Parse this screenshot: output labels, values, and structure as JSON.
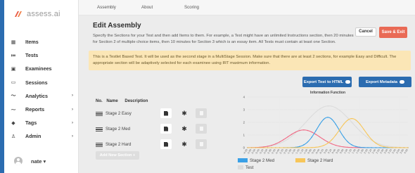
{
  "brand": {
    "logo_text": "assess.ai"
  },
  "sidebar": {
    "items": [
      {
        "label": "Items",
        "icon": "grid-icon",
        "has_chevron": false
      },
      {
        "label": "Tests",
        "icon": "list-icon",
        "has_chevron": false
      },
      {
        "label": "Examinees",
        "icon": "id-card-icon",
        "has_chevron": false
      },
      {
        "label": "Sessions",
        "icon": "calendar-icon",
        "has_chevron": false
      },
      {
        "label": "Analytics",
        "icon": "trend-icon",
        "has_chevron": true
      },
      {
        "label": "Reports",
        "icon": "report-icon",
        "has_chevron": true
      },
      {
        "label": "Tags",
        "icon": "tag-icon",
        "has_chevron": true
      },
      {
        "label": "Admin",
        "icon": "admin-icon",
        "has_chevron": true
      }
    ],
    "user": {
      "name": "nate ▾"
    }
  },
  "topnav": {
    "tabs": [
      "Assembly",
      "About",
      "Scoring"
    ]
  },
  "page": {
    "title": "Edit Assembly",
    "description": "Specify the Sections for your Test and then add Items to them. For example, a Test might have an unlimited Instructions section, then 20 minutes for Section 2 of multiple choice items, then 10 minutes for Section 3 which is an essay item. All Tests must contain at least one Section.",
    "cancel_label": "Cancel",
    "save_label": "Save & Exit",
    "banner": "This is a Testlet Based Test. It will be used as the second stage in a MultiStage Session. Make sure that there are at least 2 sections, for example Easy and Difficult. The appropriate section will be adaptively selected for each examinee using IRT maximum information.",
    "export_html_label": "Export Test to HTML",
    "export_meta_label": "Export Metadata"
  },
  "sections_table": {
    "headers": {
      "no": "No.",
      "name": "Name",
      "description": "Description"
    },
    "rows": [
      {
        "name": "Stage 2 Easy"
      },
      {
        "name": "Stage 2 Med"
      },
      {
        "name": "Stage 2 Hard"
      }
    ],
    "add_label": "Add New Section +"
  },
  "chart_data": {
    "type": "line",
    "title": "Information Function",
    "ylim": [
      0,
      4
    ],
    "yticks": [
      0,
      1,
      2,
      3,
      4
    ],
    "x": [
      -4.0,
      -3.8,
      -3.6,
      -3.4,
      -3.2,
      -3.0,
      -2.8,
      -2.6,
      -2.4,
      -2.2,
      -2.0,
      -1.8,
      -1.6,
      -1.4,
      -1.2,
      -1.0,
      -0.8,
      -0.6,
      -0.4,
      -0.2,
      0.0,
      0.2,
      0.4,
      0.6,
      0.8,
      1.0,
      1.2,
      1.4,
      1.6,
      1.8,
      2.0,
      2.2,
      2.4,
      2.6,
      2.8,
      3.0,
      3.2,
      3.4,
      3.6,
      3.8,
      4.0
    ],
    "xtick_labels": [
      "-4.00",
      "-3.80",
      "-3.60",
      "-3.40",
      "-3.20",
      "-3.00",
      "-2.80",
      "-2.60",
      "-2.40",
      "-2.20",
      "-2.00",
      "-1.80",
      "-1.60",
      "-1.40",
      "-1.20",
      "-1.00",
      "-0.80",
      "-0.60",
      "-0.40",
      "-0.20",
      "0.00",
      "0.20",
      "0.40",
      "0.60",
      "0.80",
      "1.00",
      "1.20",
      "1.40",
      "1.60",
      "1.80",
      "2.00",
      "2.20",
      "2.40",
      "2.60",
      "2.80",
      "3.00",
      "3.20",
      "3.40",
      "3.60",
      "3.80",
      "4.00"
    ],
    "series": [
      {
        "name": "Stage 2 Easy",
        "color": "#f06a85",
        "center": -1.2,
        "peak": 1.4,
        "width": 0.8
      },
      {
        "name": "Stage 2 Med",
        "color": "#3aa0e6",
        "center": 0.0,
        "peak": 2.4,
        "width": 0.55
      },
      {
        "name": "Stage 2 Hard",
        "color": "#f7c65a",
        "center": 1.2,
        "peak": 2.3,
        "width": 0.62
      },
      {
        "name": "Test",
        "color": "#dcdcdc",
        "center": 0.05,
        "peak": 3.3,
        "width": 1.15
      }
    ]
  }
}
